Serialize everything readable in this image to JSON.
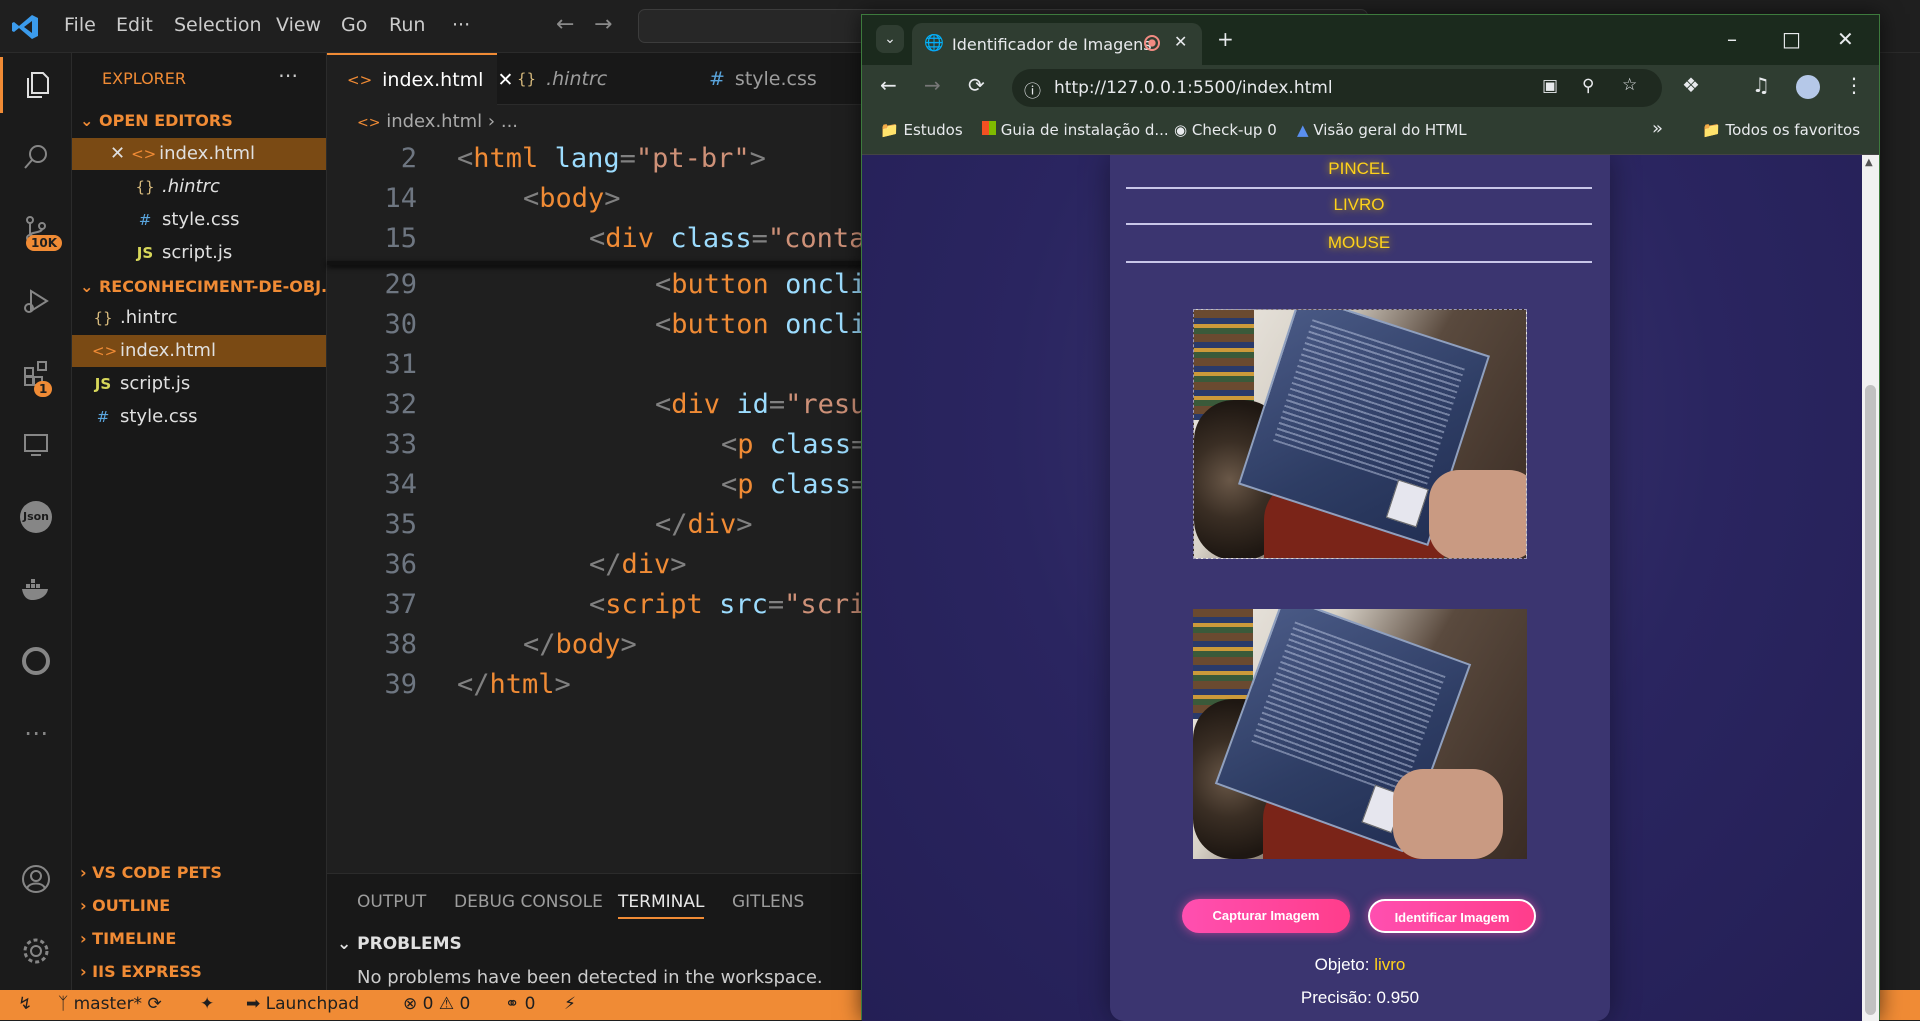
{
  "titlebar": {
    "menu": [
      "File",
      "Edit",
      "Selection",
      "View",
      "Go",
      "Run",
      "···"
    ]
  },
  "activity": {
    "scm_badge": "10K",
    "ext_badge": "1"
  },
  "sidebar": {
    "title": "EXPLORER",
    "open_editors_header": "OPEN EDITORS",
    "open_editors": [
      {
        "name": "index.html",
        "icon": "html-file-icon"
      },
      {
        "name": ".hintrc",
        "icon": "json-file-icon"
      },
      {
        "name": "style.css",
        "icon": "css-file-icon"
      },
      {
        "name": "script.js",
        "icon": "js-file-icon"
      }
    ],
    "project_header": "RECONHECIMENT-DE-OBJ...",
    "files": [
      {
        "name": ".hintrc",
        "icon": "json-file-icon"
      },
      {
        "name": "index.html",
        "icon": "html-file-icon"
      },
      {
        "name": "script.js",
        "icon": "js-file-icon"
      },
      {
        "name": "style.css",
        "icon": "css-file-icon"
      }
    ],
    "bottom_sections": [
      "VS CODE PETS",
      "OUTLINE",
      "TIMELINE",
      "IIS EXPRESS"
    ]
  },
  "editor": {
    "tabs": [
      "index.html",
      ".hintrc",
      "style.css"
    ],
    "breadcrumb_file": "index.html",
    "breadcrumb_rest": "...",
    "lines": [
      {
        "num": "2",
        "parts": [
          [
            "punct",
            "<"
          ],
          [
            "tag",
            "html"
          ],
          [
            "txt",
            " "
          ],
          [
            "attr",
            "lang"
          ],
          [
            "punct",
            "="
          ],
          [
            "str",
            "\"pt-br\""
          ],
          [
            "punct",
            ">"
          ]
        ],
        "indent": 0
      },
      {
        "num": "14",
        "parts": [
          [
            "punct",
            "<"
          ],
          [
            "tag",
            "body"
          ],
          [
            "punct",
            ">"
          ]
        ],
        "indent": 1
      },
      {
        "num": "15",
        "parts": [
          [
            "punct",
            "<"
          ],
          [
            "tag",
            "div"
          ],
          [
            "txt",
            " "
          ],
          [
            "attr",
            "class"
          ],
          [
            "punct",
            "="
          ],
          [
            "str",
            "\"conta"
          ]
        ],
        "indent": 2
      },
      {
        "num": "29",
        "parts": [
          [
            "punct",
            "<"
          ],
          [
            "tag",
            "button"
          ],
          [
            "txt",
            " "
          ],
          [
            "attr",
            "oncli"
          ]
        ],
        "indent": 3
      },
      {
        "num": "30",
        "parts": [
          [
            "punct",
            "<"
          ],
          [
            "tag",
            "button"
          ],
          [
            "txt",
            " "
          ],
          [
            "attr",
            "oncli"
          ]
        ],
        "indent": 3
      },
      {
        "num": "31",
        "parts": [],
        "indent": 3
      },
      {
        "num": "32",
        "parts": [
          [
            "punct",
            "<"
          ],
          [
            "tag",
            "div"
          ],
          [
            "txt",
            " "
          ],
          [
            "attr",
            "id"
          ],
          [
            "punct",
            "="
          ],
          [
            "str",
            "\"resu"
          ]
        ],
        "indent": 3
      },
      {
        "num": "33",
        "parts": [
          [
            "punct",
            "<"
          ],
          [
            "tag",
            "p"
          ],
          [
            "txt",
            " "
          ],
          [
            "attr",
            "class"
          ],
          [
            "punct",
            "="
          ]
        ],
        "indent": 4
      },
      {
        "num": "34",
        "parts": [
          [
            "punct",
            "<"
          ],
          [
            "tag",
            "p"
          ],
          [
            "txt",
            " "
          ],
          [
            "attr",
            "class"
          ],
          [
            "punct",
            "="
          ]
        ],
        "indent": 4
      },
      {
        "num": "35",
        "parts": [
          [
            "punct",
            "</"
          ],
          [
            "tag",
            "div"
          ],
          [
            "punct",
            ">"
          ]
        ],
        "indent": 3
      },
      {
        "num": "36",
        "parts": [
          [
            "punct",
            "</"
          ],
          [
            "tag",
            "div"
          ],
          [
            "punct",
            ">"
          ]
        ],
        "indent": 2
      },
      {
        "num": "37",
        "parts": [
          [
            "punct",
            "<"
          ],
          [
            "tag",
            "script"
          ],
          [
            "txt",
            " "
          ],
          [
            "attr",
            "src"
          ],
          [
            "punct",
            "="
          ],
          [
            "str",
            "\"scri"
          ]
        ],
        "indent": 2
      },
      {
        "num": "38",
        "parts": [
          [
            "punct",
            "</"
          ],
          [
            "tag",
            "body"
          ],
          [
            "punct",
            ">"
          ]
        ],
        "indent": 1
      },
      {
        "num": "39",
        "parts": [
          [
            "punct",
            "</"
          ],
          [
            "tag",
            "html"
          ],
          [
            "punct",
            ">"
          ]
        ],
        "indent": 0
      }
    ]
  },
  "panel": {
    "tabs": [
      "OUTPUT",
      "DEBUG CONSOLE",
      "TERMINAL",
      "GITLENS"
    ],
    "active_tab": "TERMINAL",
    "problems_header": "PROBLEMS",
    "problems_message": "No problems have been detected in the workspace."
  },
  "statusbar": {
    "branch": "master*",
    "launchpad": "Launchpad",
    "errors": "0",
    "warnings": "0",
    "ports": "0"
  },
  "browser": {
    "tab_title": "Identificador de Imagens",
    "url": "http://127.0.0.1:5500/index.html",
    "bookmarks": [
      "Estudos",
      "Guia de instalação d...",
      "Check-up 0",
      "Visão geral do HTML"
    ],
    "all_bookmarks": "Todos os favoritos"
  },
  "page": {
    "options": [
      "PINCEL",
      "LIVRO",
      "MOUSE"
    ],
    "capture_label": "Capturar Imagem",
    "identify_label": "Identificar Imagem",
    "object_label": "Objeto:",
    "object_value": "livro",
    "precision_label": "Precisão:",
    "precision_value": "0.950"
  },
  "colors": {
    "accent": "#f08b35",
    "highlight": "#ffd21a",
    "button_pink": "#ff3d8b"
  }
}
